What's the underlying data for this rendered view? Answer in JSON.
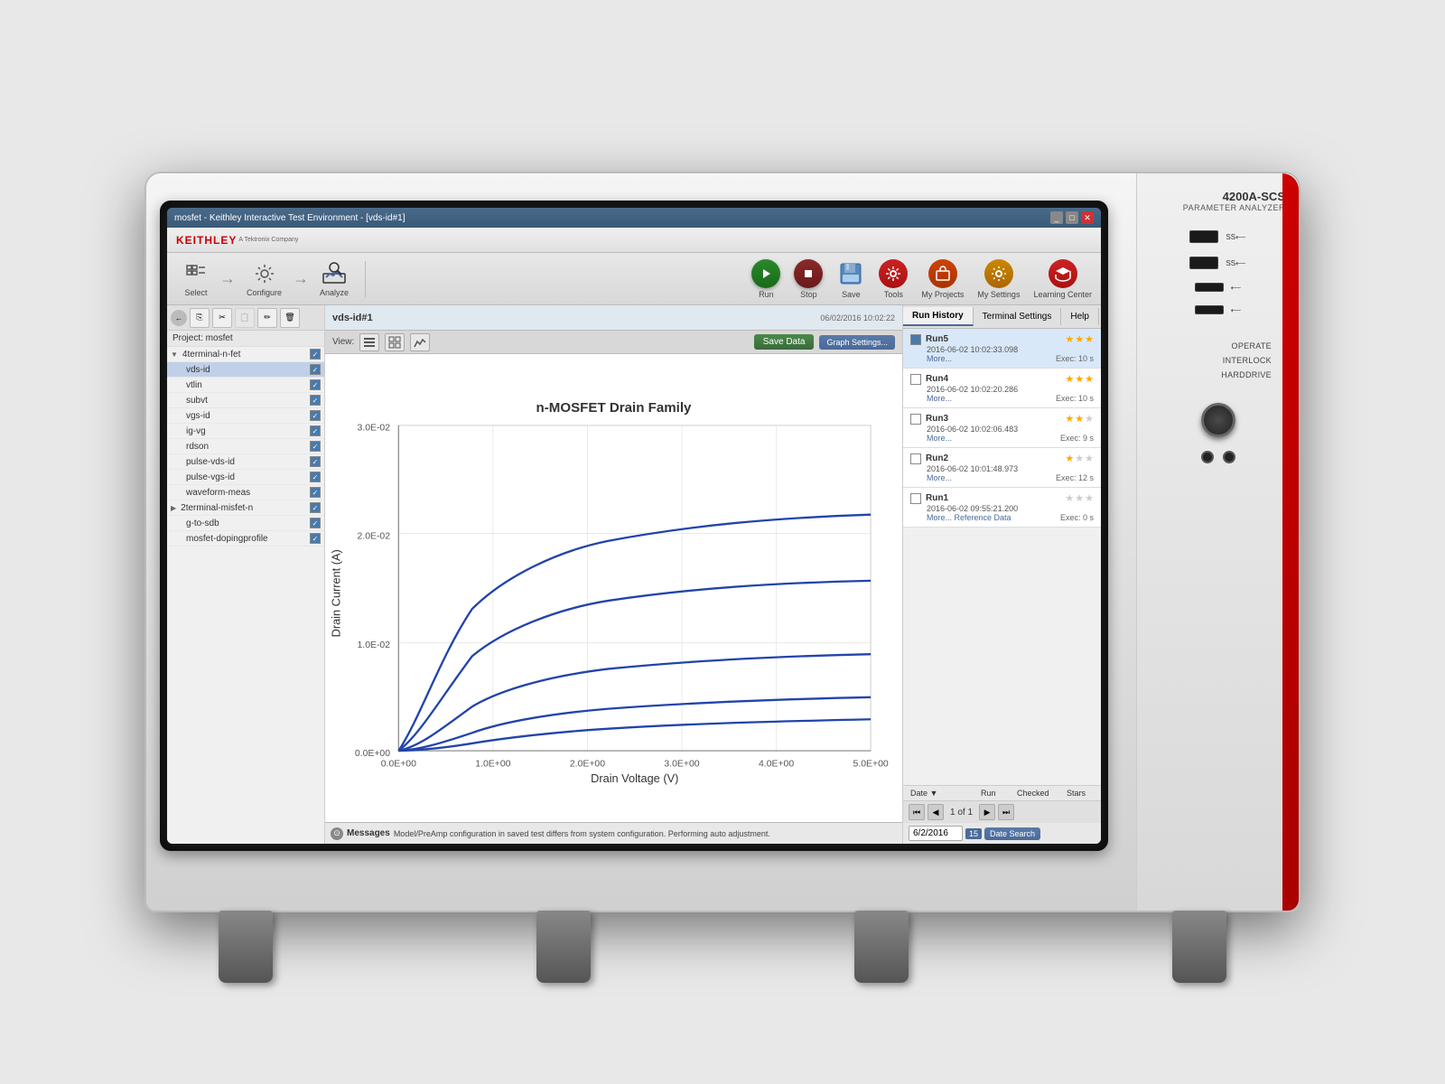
{
  "instrument": {
    "model": "4200A-SCS",
    "description": "PARAMETER ANALYZER"
  },
  "window": {
    "title": "mosfet - Keithley Interactive Test Environment - [vds-id#1]",
    "brand": "KEITHLEY",
    "brand_sub": "A Tektronix Company"
  },
  "toolbar": {
    "select_label": "Select",
    "configure_label": "Configure",
    "analyze_label": "Analyze",
    "run_label": "Run",
    "stop_label": "Stop",
    "save_label": "Save",
    "tools_label": "Tools",
    "myprojects_label": "My Projects",
    "mysettings_label": "My Settings",
    "learningcenter_label": "Learning Center"
  },
  "sidebar": {
    "nav_buttons": [
      "←",
      "→"
    ],
    "project_label": "Project: mosfet",
    "tree": [
      {
        "level": 1,
        "label": "4terminal-n-fet",
        "arrow": "▼",
        "checked": true
      },
      {
        "level": 2,
        "label": "vds-id",
        "checked": true,
        "selected": true
      },
      {
        "level": 2,
        "label": "vtlin",
        "checked": true
      },
      {
        "level": 2,
        "label": "subvt",
        "checked": true
      },
      {
        "level": 2,
        "label": "vgs-id",
        "checked": true
      },
      {
        "level": 2,
        "label": "ig-vg",
        "checked": true
      },
      {
        "level": 2,
        "label": "rdson",
        "checked": true
      },
      {
        "level": 2,
        "label": "pulse-vds-id",
        "checked": true
      },
      {
        "level": 2,
        "label": "pulse-vgs-id",
        "checked": true
      },
      {
        "level": 2,
        "label": "waveform-meas",
        "checked": true
      },
      {
        "level": 1,
        "label": "2terminal-misfet-n",
        "arrow": "▶",
        "checked": true
      },
      {
        "level": 2,
        "label": "g-to-sdb",
        "checked": true
      },
      {
        "level": 2,
        "label": "mosfet-dopingprofile",
        "checked": true
      }
    ]
  },
  "chart": {
    "title": "vds-id#1",
    "date": "06/02/2016 10:02:22",
    "graph_title": "n-MOSFET Drain Family",
    "x_label": "Drain Voltage (V)",
    "y_label": "Drain Current (A)",
    "x_axis": [
      "0.0E+00",
      "1.0E+00",
      "2.0E+00",
      "3.0E+00",
      "4.0E+00",
      "5.0E+00"
    ],
    "y_axis": [
      "0.0E+00",
      "1.0E-02",
      "2.0E-02",
      "3.0E-02"
    ],
    "save_data_label": "Save Data",
    "graph_settings_label": "Graph Settings..."
  },
  "view": {
    "label": "View:"
  },
  "messages": {
    "label": "Messages",
    "text": "Model/PreAmp configuration in saved test differs from system configuration. Performing auto adjustment."
  },
  "run_history": {
    "tabs": [
      "Run History",
      "Terminal Settings",
      "Help"
    ],
    "active_tab": "Run History",
    "runs": [
      {
        "name": "Run5",
        "date": "2016-06-02 10:02:33.098",
        "more": "More...",
        "exec": "Exec: 10 s",
        "stars": 3,
        "checked": true
      },
      {
        "name": "Run4",
        "date": "2016-06-02 10:02:20.286",
        "more": "More...",
        "exec": "Exec: 10 s",
        "stars": 3,
        "checked": false
      },
      {
        "name": "Run3",
        "date": "2016-06-02 10:02:06.483",
        "more": "More...",
        "exec": "Exec: 9 s",
        "stars": 2,
        "checked": false
      },
      {
        "name": "Run2",
        "date": "2016-06-02 10:01:48.973",
        "more": "More...",
        "exec": "Exec: 12 s",
        "stars": 1,
        "checked": false
      },
      {
        "name": "Run1",
        "date": "2016-06-02 09:55:21.200",
        "more": "More... Reference Data",
        "exec": "Exec: 0 s",
        "stars": 0,
        "checked": false
      }
    ],
    "sort_cols": [
      "Date ▼",
      "Run",
      "Checked",
      "Stars"
    ],
    "pager": "1 of 1",
    "date_value": "6/2/2016",
    "date_num": "15",
    "date_search_label": "Date Search"
  },
  "status_indicators": {
    "operate": "OPERATE",
    "interlock": "INTERLOCK",
    "harddrive": "HARDDRIVE"
  }
}
